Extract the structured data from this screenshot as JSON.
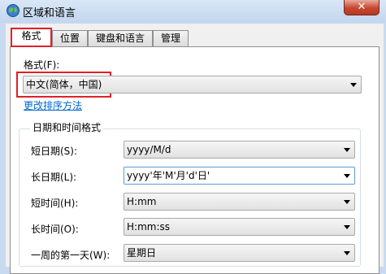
{
  "window": {
    "title": "区域和语言",
    "close_label": "✕"
  },
  "tabs": [
    {
      "label": "格式",
      "active": true
    },
    {
      "label": "位置",
      "active": false
    },
    {
      "label": "键盘和语言",
      "active": false
    },
    {
      "label": "管理",
      "active": false
    }
  ],
  "format": {
    "label": "格式(F):",
    "value": "中文(简体，中国)",
    "link": "更改排序方法"
  },
  "datetime": {
    "group_title": "日期和时间格式",
    "rows": [
      {
        "label": "短日期(S):",
        "value": "yyyy/M/d"
      },
      {
        "label": "长日期(L):",
        "value": "yyyy'年'M'月'd'日'"
      },
      {
        "label": "短时间(H):",
        "value": "H:mm"
      },
      {
        "label": "长时间(O):",
        "value": "H:mm:ss"
      },
      {
        "label": "一周的第一天(W):",
        "value": "星期日"
      }
    ]
  },
  "colors": {
    "highlight_box": "#e0202a",
    "link": "#0066cc",
    "close_button": "#c7462f"
  }
}
